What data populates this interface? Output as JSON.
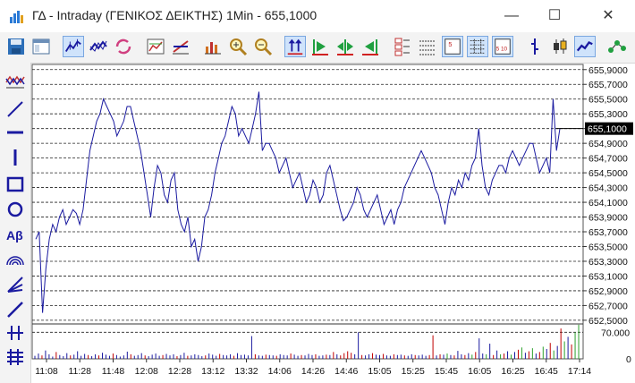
{
  "window": {
    "title": "ΓΔ - Intraday (ΓΕΝΙΚΟΣ ΔΕΙΚΤΗΣ) 1Min - 655,1000",
    "minimize_glyph": "—",
    "maximize_glyph": "☐",
    "close_glyph": "✕"
  },
  "toolbar": {
    "icons": [
      "save-icon",
      "window-icon",
      "line-chart-icon",
      "candle-chart-icon",
      "refresh-icon",
      "chart-properties-icon",
      "indicator-icon",
      "bar-chart-icon",
      "zoom-in-icon",
      "zoom-out-icon",
      "fit-vertical-icon",
      "scroll-right-icon",
      "scroll-both-icon",
      "scroll-left-icon",
      "price-levels-icon",
      "grid-icon",
      "grid-5-icon",
      "grid-5-10-icon",
      "bar-style-icon",
      "candle-style-icon",
      "line-style-icon",
      "connect-icon"
    ],
    "text_glyphs": {
      "grid5": "5",
      "grid510": "5 10"
    }
  },
  "drawing_tools": {
    "icons": [
      "indicator-wave-icon",
      "trendline-icon",
      "horizontal-line-icon",
      "vertical-line-icon",
      "rectangle-icon",
      "ellipse-icon",
      "text-tool-icon",
      "fan-icon",
      "fibonacci-icon",
      "pen-icon",
      "cross-line-icon",
      "channel-icon"
    ],
    "text_tool_label": "Aβ"
  },
  "chart_data": {
    "type": "line",
    "price_axis_ticks": [
      "655,9000",
      "655,7000",
      "655,5000",
      "655,3000",
      "655,1000",
      "654,9000",
      "654,7000",
      "654,5000",
      "654,3000",
      "654,1000",
      "653,9000",
      "653,7000",
      "653,5000",
      "653,3000",
      "653,1000",
      "652,9000",
      "652,7000",
      "652,5000"
    ],
    "price_ylim": [
      652.45,
      655.97
    ],
    "current_value_label": "655,1000",
    "current_value": 655.1,
    "volume_axis_ticks": [
      "70.000",
      "0"
    ],
    "volume_ylim": [
      0,
      92000
    ],
    "time_ticks": [
      "11:08",
      "11:28",
      "11:48",
      "12:08",
      "12:28",
      "13:12",
      "13:32",
      "14:06",
      "14:26",
      "14:46",
      "15:05",
      "15:25",
      "15:45",
      "16:05",
      "16:25",
      "16:45",
      "17:14"
    ],
    "series": [
      {
        "values": [
          653.6,
          653.7,
          652.6,
          653.2,
          653.6,
          653.8,
          653.7,
          653.9,
          654.0,
          653.8,
          653.9,
          654.0,
          653.95,
          653.8,
          654.0,
          654.4,
          654.8,
          655.0,
          655.2,
          655.3,
          655.5,
          655.4,
          655.3,
          655.2,
          655.0,
          655.1,
          655.2,
          655.4,
          655.4,
          655.2,
          655.0,
          654.8,
          654.5,
          654.2,
          653.9,
          654.3,
          654.6,
          654.5,
          654.2,
          654.1,
          654.4,
          654.5,
          654.0,
          653.8,
          653.7,
          653.9,
          653.5,
          653.6,
          653.3,
          653.5,
          653.9,
          654.0,
          654.2,
          654.5,
          654.7,
          654.9,
          655.0,
          655.2,
          655.4,
          655.3,
          655.0,
          655.1,
          655.0,
          654.9,
          655.1,
          655.3,
          655.6,
          654.8,
          654.9,
          654.9,
          654.8,
          654.7,
          654.5,
          654.6,
          654.7,
          654.5,
          654.3,
          654.4,
          654.5,
          654.3,
          654.1,
          654.2,
          654.4,
          654.3,
          654.1,
          654.2,
          654.5,
          654.6,
          654.4,
          654.2,
          654.0,
          653.85,
          653.9,
          654.0,
          654.1,
          654.3,
          654.2,
          654.0,
          653.9,
          654.0,
          654.1,
          654.2,
          654.0,
          653.8,
          653.9,
          654.0,
          653.8,
          654.0,
          654.1,
          654.3,
          654.4,
          654.5,
          654.6,
          654.7,
          654.8,
          654.7,
          654.6,
          654.5,
          654.3,
          654.2,
          654.0,
          653.8,
          654.1,
          654.3,
          654.2,
          654.4,
          654.3,
          654.5,
          654.4,
          654.6,
          654.7,
          655.1,
          654.6,
          654.3,
          654.2,
          654.4,
          654.5,
          654.6,
          654.6,
          654.5,
          654.7,
          654.8,
          654.7,
          654.6,
          654.7,
          654.8,
          654.9,
          654.9,
          654.7,
          654.5,
          654.6,
          654.7,
          654.5,
          655.5,
          654.8,
          655.1
        ]
      }
    ],
    "volume": {
      "colors": {
        "up": "#2ca02c",
        "down": "#c00000",
        "neutral": "#1a1aa0"
      },
      "values": [
        8000,
        14000,
        9000,
        22000,
        12000,
        6000,
        18000,
        10000,
        7000,
        15000,
        9000,
        11000,
        20000,
        8000,
        13000,
        10000,
        7000,
        12000,
        9000,
        16000,
        11000,
        8000,
        14000,
        10000,
        6000,
        9000,
        19000,
        12000,
        8000,
        10000,
        15000,
        9000,
        7000,
        11000,
        14000,
        8000,
        10000,
        13000,
        9000,
        12000,
        7000,
        10000,
        16000,
        8000,
        9000,
        12000,
        10000,
        7000,
        9000,
        14000,
        11000,
        8000,
        13000,
        10000,
        9000,
        12000,
        8000,
        15000,
        10000,
        11000,
        9000,
        60000,
        12000,
        9000,
        8000,
        11000,
        10000,
        9000,
        8000,
        12000,
        10000,
        9000,
        14000,
        11000,
        8000,
        10000,
        9000,
        13000,
        10000,
        12000,
        8000,
        9000,
        11000,
        10000,
        18000,
        12000,
        9000,
        15000,
        20000,
        16000,
        12000,
        70000,
        10000,
        9000,
        12000,
        15000,
        11000,
        10000,
        13000,
        9000,
        8000,
        12000,
        10000,
        11000,
        9000,
        8000,
        12000,
        10000,
        9000,
        11000,
        8000,
        10000,
        62000,
        9000,
        12000,
        11000,
        14000,
        10000,
        9000,
        21000,
        12000,
        10000,
        15000,
        11000,
        18000,
        54000,
        14000,
        12000,
        40000,
        10000,
        22000,
        12000,
        14000,
        20000,
        11000,
        18000,
        24000,
        30000,
        16000,
        20000,
        28000,
        14000,
        18000,
        32000,
        26000,
        42000,
        22000,
        34000,
        80000,
        46000,
        58000,
        38000,
        70000,
        90000
      ],
      "sides": [
        "n",
        "n",
        "d",
        "n",
        "n",
        "n",
        "d",
        "n",
        "n",
        "n",
        "d",
        "n",
        "n",
        "n",
        "n",
        "d",
        "n",
        "n",
        "d",
        "n",
        "n",
        "n",
        "d",
        "n",
        "n",
        "n",
        "n",
        "d",
        "n",
        "n",
        "n",
        "d",
        "n",
        "n",
        "n",
        "n",
        "d",
        "n",
        "n",
        "n",
        "d",
        "n",
        "n",
        "d",
        "n",
        "n",
        "n",
        "n",
        "d",
        "n",
        "n",
        "n",
        "d",
        "n",
        "n",
        "n",
        "d",
        "n",
        "n",
        "n",
        "n",
        "n",
        "d",
        "n",
        "n",
        "d",
        "n",
        "n",
        "d",
        "n",
        "n",
        "n",
        "d",
        "n",
        "n",
        "d",
        "n",
        "n",
        "n",
        "d",
        "n",
        "n",
        "d",
        "n",
        "d",
        "n",
        "d",
        "d",
        "d",
        "d",
        "n",
        "n",
        "d",
        "n",
        "n",
        "d",
        "n",
        "n",
        "d",
        "n",
        "n",
        "d",
        "n",
        "n",
        "d",
        "n",
        "n",
        "d",
        "n",
        "n",
        "n",
        "d",
        "d",
        "n",
        "d",
        "n",
        "u",
        "n",
        "d",
        "n",
        "n",
        "d",
        "n",
        "u",
        "d",
        "n",
        "n",
        "u",
        "n",
        "d",
        "n",
        "u",
        "d",
        "n",
        "u",
        "n",
        "d",
        "u",
        "n",
        "d",
        "u",
        "n",
        "d",
        "u",
        "n",
        "d",
        "u",
        "n",
        "d",
        "u",
        "n",
        "d",
        "u",
        "u"
      ]
    },
    "price_line_color": "#1a1aa0",
    "grid": true,
    "current_label_bg": "#000000"
  }
}
